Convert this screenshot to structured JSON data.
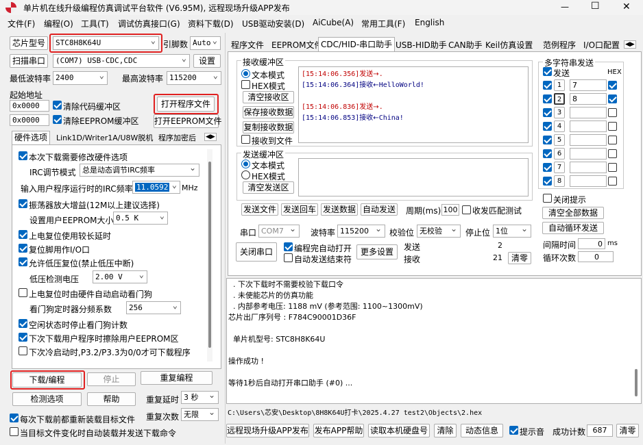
{
  "window": {
    "title": "单片机在线升级编程仿真调试平台软件 (V6.95M), 远程现场升级APP发布",
    "minimize": "—",
    "maximize": "☐",
    "close": "✕"
  },
  "menu": [
    "文件(F)",
    "编程(O)",
    "工具(T)",
    "调试仿真接口(G)",
    "资料下载(D)",
    "USB驱动安装(D)",
    "AiCube(A)",
    "常用工具(F)",
    "English"
  ],
  "left": {
    "chip_label": "芯片型号",
    "chip_value": "STC8H8K64U",
    "pins_label": "引脚数",
    "pins_value": "Auto",
    "scan_label": "扫描串口",
    "port_value": "(COM7) USB-CDC,CDC",
    "settings_label": "设置",
    "min_baud_label": "最低波特率",
    "min_baud_value": "2400",
    "max_baud_label": "最高波特率",
    "max_baud_value": "115200",
    "start_addr_label": "起始地址",
    "addr1": "0x0000",
    "clear_code_label": "清除代码缓冲区",
    "open_prog_label": "打开程序文件",
    "addr2": "0x0000",
    "clear_eeprom_label": "清除EEPROM缓冲区",
    "open_eeprom_label": "打开EEPROM文件",
    "tabs": [
      "硬件选项",
      "Link1D/Writer1A/U8W脱机",
      "程序加密后"
    ],
    "options": {
      "modify_hw": "本次下载需要修改硬件选项",
      "irc_mode_label": "IRC调节模式",
      "irc_mode_value": "总是动态调节IRC频率",
      "irc_freq_label": "输入用户程序运行时的IRC频率",
      "irc_freq_value": "11.0592",
      "mhz": "MHz",
      "osc_gain": "振荡器放大增益(12M以上建议选择)",
      "eeprom_size_label": "设置用户EEPROM大小",
      "eeprom_size_value": "0.5 K",
      "power_reset": "上电复位使用较长延时",
      "reset_io": "复位脚用作I/O口",
      "lvd_reset": "允许低压复位(禁止低压中断)",
      "lvd_label": "低压检测电压",
      "lvd_value": "2.00 V",
      "wdt_start": "上电复位时由硬件自动启动看门狗",
      "wdt_div_label": "看门狗定时器分频系数",
      "wdt_div_value": "256",
      "idle_wdt": "空闲状态时停止看门狗计数",
      "erase_eeprom": "下次下载用户程序时擦除用户EEPROM区",
      "cold_boot": "下次冷启动时,P3.2/P3.3为0/0才可下载程序"
    },
    "download_label": "下载/编程",
    "stop_label": "停止",
    "reprogram_label": "重复编程",
    "detect_label": "检测选项",
    "help_label": "帮助",
    "repeat_delay_label": "重复延时",
    "repeat_delay_value": "3 秒",
    "repeat_count_label": "重复次数",
    "repeat_count_value": "无限",
    "reload_label": "每次下载前都重新装载目标文件",
    "auto_load_label": "当目标文件变化时自动装载并发送下载命令"
  },
  "right_tabs": [
    "程序文件",
    "EEPROM文件",
    "CDC/HID-串口助手",
    "USB-HID助手",
    "CAN助手",
    "Keil仿真设置",
    "范例程序",
    "I/O口配置"
  ],
  "receive": {
    "group": "接收缓冲区",
    "text_mode": "文本模式",
    "hex_mode": "HEX模式",
    "clear": "清空接收区",
    "save": "保存接收数据",
    "copy": "复制接收数据",
    "to_file": "接收到文件",
    "lines": [
      {
        "time": "[15:14:06.356]",
        "dir": "发送→",
        "text": ".",
        "color": "#c00000"
      },
      {
        "time": "[15:14:06.364]",
        "dir": "接收←",
        "text": "HelloWorld!",
        "color": "#000080"
      },
      {
        "time": "",
        "dir": "",
        "text": "",
        "color": "#000080"
      },
      {
        "time": "[15:14:06.836]",
        "dir": "发送→",
        "text": ".",
        "color": "#c00000"
      },
      {
        "time": "[15:14:06.853]",
        "dir": "接收←",
        "text": "China!",
        "color": "#000080"
      }
    ]
  },
  "send": {
    "group": "发送缓冲区",
    "text_mode": "文本模式",
    "hex_mode": "HEX模式",
    "clear": "清空发送区"
  },
  "multi": {
    "group": "多字符串发送",
    "send": "发送",
    "hex": "HEX",
    "rows": [
      {
        "n": "1",
        "v": "7"
      },
      {
        "n": "2",
        "v": "8"
      },
      {
        "n": "3",
        "v": ""
      },
      {
        "n": "4",
        "v": ""
      },
      {
        "n": "5",
        "v": ""
      },
      {
        "n": "6",
        "v": ""
      },
      {
        "n": "7",
        "v": ""
      },
      {
        "n": "8",
        "v": ""
      }
    ],
    "close_hint": "关闭提示",
    "clear_all": "清空全部数据",
    "auto_cycle": "自动循环发送",
    "interval_label": "间隔时间",
    "interval_value": "0",
    "ms": "ms",
    "cycles_label": "循环次数",
    "cycles_value": "0"
  },
  "serial": {
    "send_file": "发送文件",
    "send_return": "发送回车",
    "send_data": "发送数据",
    "auto_send": "自动发送",
    "period_label": "周期(ms)",
    "period_value": "100",
    "match_label": "收发匹配测试",
    "port_label": "串口",
    "port_value": "COM7",
    "baud_label": "波特率",
    "baud_value": "115200",
    "parity_label": "校验位",
    "parity_value": "无校验",
    "stop_label": "停止位",
    "stop_value": "1位",
    "close_port": "关闭串口",
    "auto_open": "编程完自动打开",
    "auto_end": "自动发送结束符",
    "more": "更多设置",
    "sent_label": "发送",
    "sent_value": "2",
    "recv_label": "接收",
    "recv_value": "21",
    "clear_count": "清零"
  },
  "log": [
    "  . 下次下载时不需要校验下载口令",
    "  . 未使能芯片的仿真功能",
    "  . 内部参考电压: 1188 mV (参考范围: 1100~1300mV)",
    "芯片出厂序列号 : F784C90001D36F",
    "",
    "  单片机型号: STC8H8K64U",
    "",
    "操作成功 !",
    "",
    "等待1秒后自动打开串口助手 (#0) ..."
  ],
  "path": "C:\\Users\\芯安\\Desktop\\8H8K64U打卡\\2025.4.27 test2\\Objects\\2.hex",
  "bottom": {
    "publish": "远程现场升级APP发布",
    "publish_help": "发布APP帮助",
    "read_disk": "读取本机硬盘号",
    "clear": "清除",
    "dynamic": "动态信息",
    "beep": "提示音",
    "success_label": "成功计数",
    "success_value": "687",
    "clear_count": "清零"
  },
  "colors": {
    "accent": "#0067c0",
    "highlight": "#e02020"
  }
}
